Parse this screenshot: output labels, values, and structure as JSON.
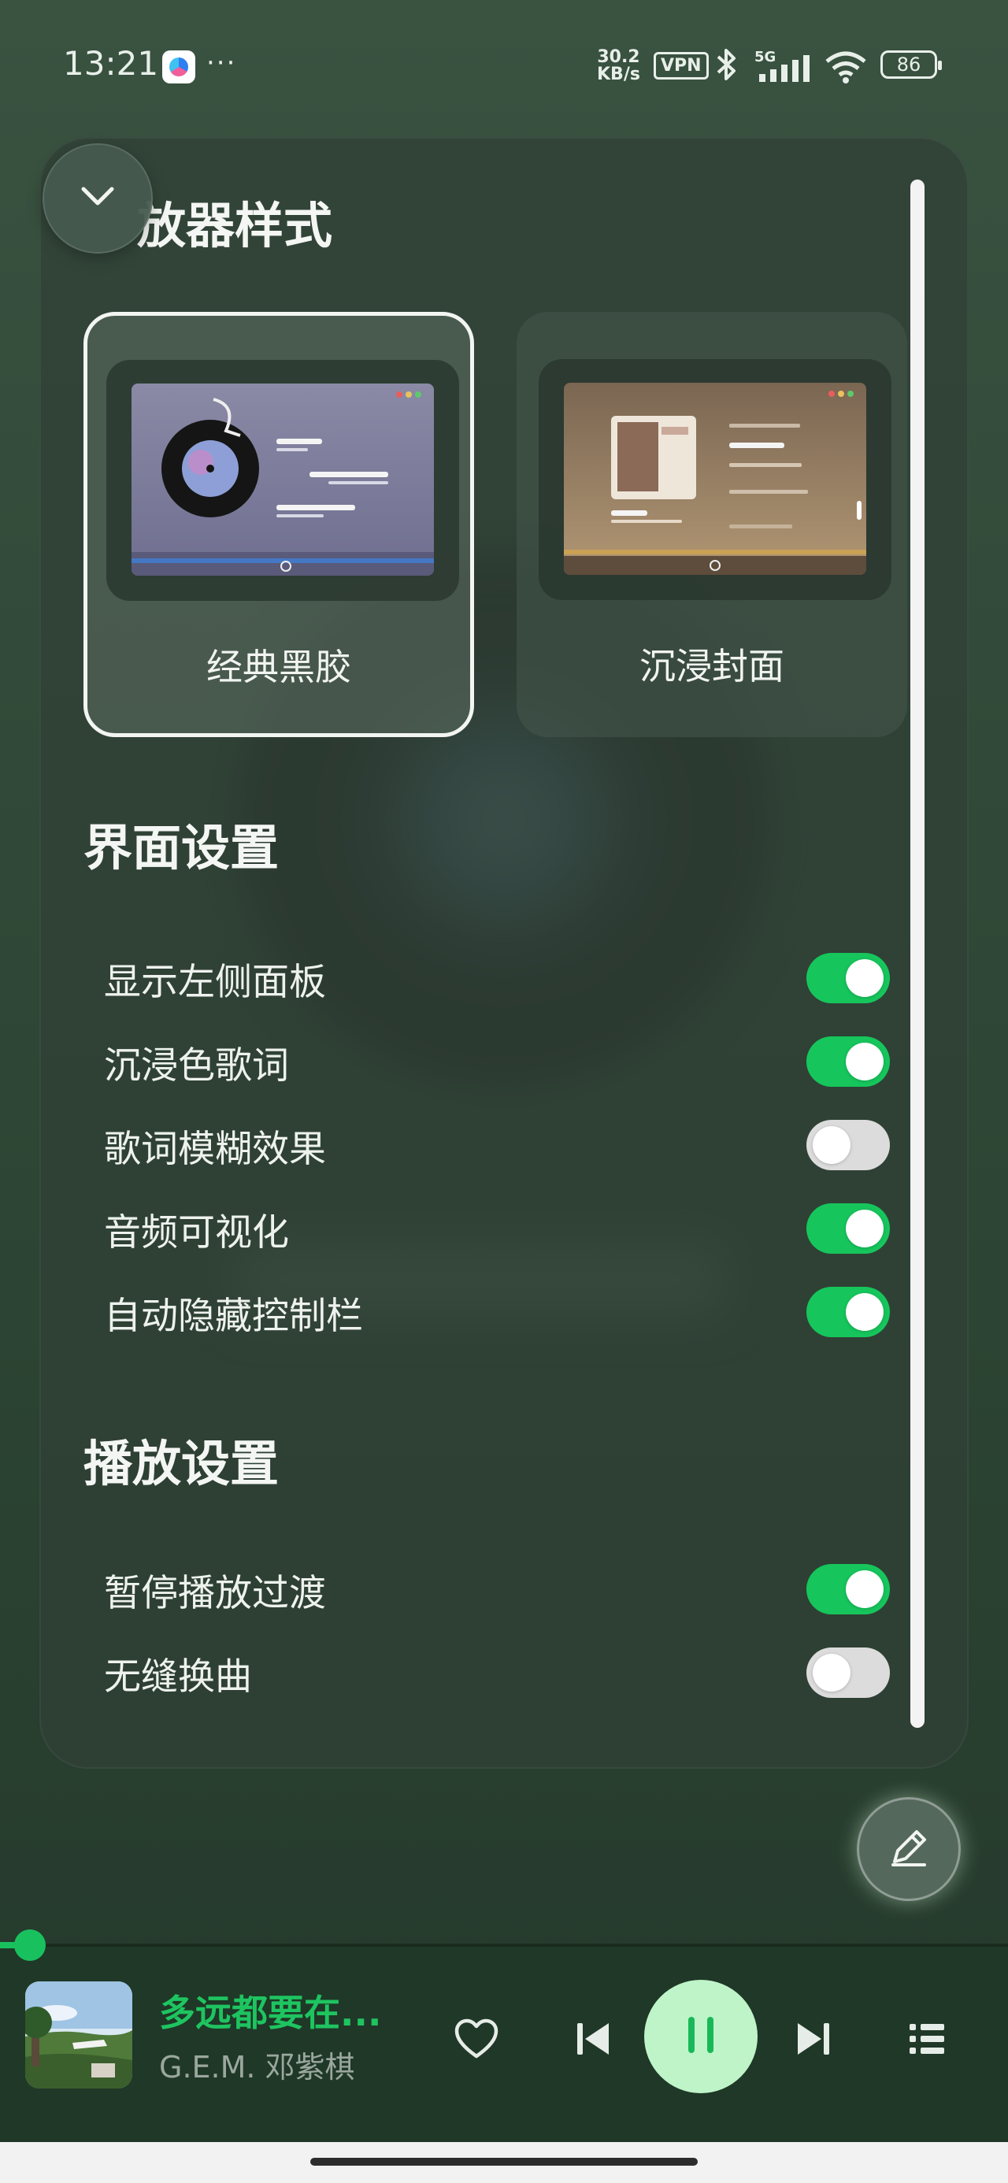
{
  "status_bar": {
    "time": "13:21",
    "overflow": "···",
    "net_speed_value": "30.2",
    "net_speed_unit": "KB/s",
    "vpn": "VPN",
    "network_type": "5G",
    "battery": "86"
  },
  "panel": {
    "player_style_title": "放器样式",
    "styles": [
      {
        "label": "经典黑胶",
        "selected": true
      },
      {
        "label": "沉浸封面",
        "selected": false
      }
    ],
    "interface_title": "界面设置",
    "interface_settings": [
      {
        "label": "显示左侧面板",
        "on": true
      },
      {
        "label": "沉浸色歌词",
        "on": true
      },
      {
        "label": "歌词模糊效果",
        "on": false
      },
      {
        "label": "音频可视化",
        "on": true
      },
      {
        "label": "自动隐藏控制栏",
        "on": true
      }
    ],
    "playback_title": "播放设置",
    "playback_settings": [
      {
        "label": "暂停播放过渡",
        "on": true
      },
      {
        "label": "无缝换曲",
        "on": false
      }
    ]
  },
  "player": {
    "title": "多远都要在...",
    "artist": "G.E.M. 邓紫棋",
    "progress": 0.03,
    "state": "playing"
  },
  "colors": {
    "accent": "#18c15e",
    "toggle_off": "#dcdcdc",
    "play_button": "#bff4c8"
  },
  "icons": [
    "chevron-down-icon",
    "pencil-icon",
    "heart-icon",
    "previous-icon",
    "pause-icon",
    "next-icon",
    "queue-icon"
  ]
}
